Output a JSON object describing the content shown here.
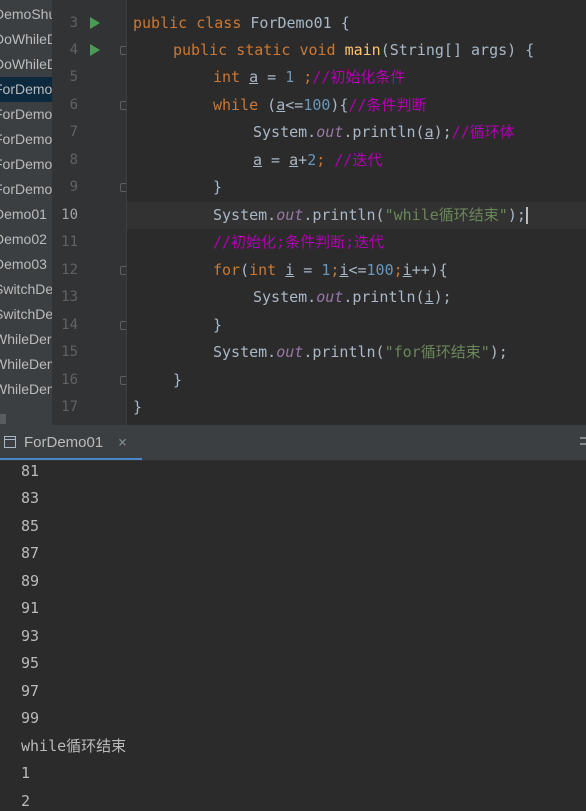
{
  "project": {
    "files": [
      {
        "label": "DemoShu",
        "selected": false
      },
      {
        "label": "DoWhileD",
        "selected": false
      },
      {
        "label": "DoWhileD",
        "selected": false
      },
      {
        "label": "ForDemo",
        "selected": true
      },
      {
        "label": "ForDemo",
        "selected": false
      },
      {
        "label": "ForDemo",
        "selected": false
      },
      {
        "label": "ForDemo",
        "selected": false
      },
      {
        "label": "ForDemo",
        "selected": false
      },
      {
        "label": "Demo01",
        "selected": false
      },
      {
        "label": "Demo02",
        "selected": false
      },
      {
        "label": "Demo03",
        "selected": false
      },
      {
        "label": "SwitchDe",
        "selected": false
      },
      {
        "label": "SwitchDe",
        "selected": false
      },
      {
        "label": "WhileDer",
        "selected": false
      },
      {
        "label": "WhileDem",
        "selected": false
      },
      {
        "label": "WhileDem",
        "selected": false
      }
    ]
  },
  "editor": {
    "line_numbers": [
      "3",
      "4",
      "5",
      "6",
      "7",
      "8",
      "9",
      "10",
      "11",
      "12",
      "13",
      "14",
      "15",
      "16",
      "17"
    ],
    "current_line": "10",
    "code": {
      "l3_public": "public",
      "l3_class": "class",
      "l3_name": "ForDemo01",
      "l3_brace": "{",
      "l4_public": "public",
      "l4_static": "static",
      "l4_void": "void",
      "l4_main": "main",
      "l4_params": "(String[] args) {",
      "l5_int": "int",
      "l5_var": "a",
      "l5_eq": " = ",
      "l5_num": "1",
      "l5_semi": " ;",
      "l5_comment": "//初始化条件",
      "l6_while": "while",
      "l6_open": " (",
      "l6_var": "a",
      "l6_cmp": "<=",
      "l6_num": "100",
      "l6_close": "){",
      "l6_comment": "//条件判断",
      "l7_sys": "System.",
      "l7_out": "out",
      "l7_println": ".println(",
      "l7_var": "a",
      "l7_end": ");",
      "l7_comment": "//循环体",
      "l8_var1": "a",
      "l8_eq": " = ",
      "l8_var2": "a",
      "l8_plus": "+",
      "l8_num": "2",
      "l8_semi": "; ",
      "l8_comment": "//迭代",
      "l9_brace": "}",
      "l10_sys": "System.",
      "l10_out": "out",
      "l10_println": ".println(",
      "l10_str": "\"while循环结束\"",
      "l10_end": ");",
      "l11_comment": "//初始化;条件判断;迭代",
      "l12_for": "for",
      "l12_open": "(",
      "l12_int": "int",
      "l12_var1": "i",
      "l12_eq": " = ",
      "l12_num1": "1",
      "l12_semi1": ";",
      "l12_var2": "i",
      "l12_cmp": "<=",
      "l12_num2": "100",
      "l12_semi2": ";",
      "l12_var3": "i",
      "l12_inc": "++){",
      "l13_sys": "System.",
      "l13_out": "out",
      "l13_println": ".println(",
      "l13_var": "i",
      "l13_end": ");",
      "l14_brace": "}",
      "l15_sys": "System.",
      "l15_out": "out",
      "l15_println": ".println(",
      "l15_str": "\"for循环结束\"",
      "l15_end": ");",
      "l16_brace": "}",
      "l17_brace": "}"
    }
  },
  "run_panel": {
    "tab_label": "ForDemo01",
    "close_glyph": "×"
  },
  "console": {
    "lines": [
      "81",
      "83",
      "85",
      "87",
      "89",
      "91",
      "93",
      "95",
      "97",
      "99",
      "while循环结束",
      "1",
      "2"
    ]
  },
  "colors": {
    "keyword": "#cc7832",
    "number": "#6897bb",
    "comment": "#b200b2",
    "string": "#6a8759",
    "method": "#ffc66d",
    "field": "#9876aa",
    "run_icon": "#499c54"
  }
}
